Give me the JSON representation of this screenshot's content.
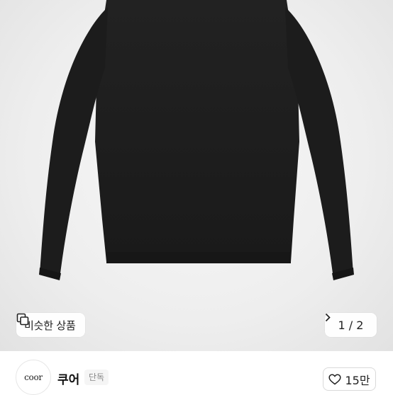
{
  "product": {
    "image_subject": "black long-sleeve knit sweater",
    "image_bg_color": "#eeeeee",
    "garment_color": "#1d1d1d"
  },
  "similar_button": {
    "label": "비슷한 상품",
    "icon": "similar-items-icon"
  },
  "pagination": {
    "text": "1 / 2",
    "icon": "chevron-right-icon"
  },
  "seller": {
    "avatar_text": "coor",
    "name": "쿠어",
    "badge": "단독"
  },
  "like": {
    "count": "15만",
    "icon": "heart-outline-icon"
  }
}
